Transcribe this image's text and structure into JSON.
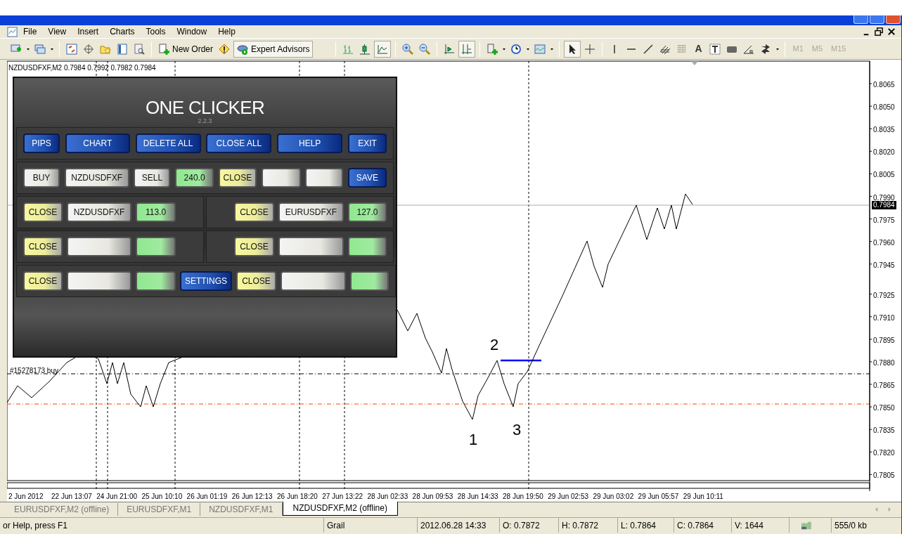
{
  "menu": [
    "File",
    "View",
    "Insert",
    "Charts",
    "Tools",
    "Window",
    "Help"
  ],
  "toolbar": {
    "new_order": "New Order",
    "expert_advisors": {
      "label": "Expert Advisors",
      "on": true
    },
    "text_tool": "A",
    "timeframes": [
      {
        "label": "M1",
        "disabled": true
      },
      {
        "label": "M5",
        "disabled": true
      },
      {
        "label": "M15",
        "disabled": true
      }
    ]
  },
  "chart": {
    "header": "NZDUSDFXF,M2  0.7984 0.7992 0.7982 0.7984",
    "order_label": "#15278173 buy",
    "current_price": "0.7984",
    "price_labels": [
      "0.8065",
      "0.8050",
      "0.8035",
      "0.8020",
      "0.8005",
      "0.7990",
      "0.7975",
      "0.7960",
      "0.7945",
      "0.7925",
      "0.7910",
      "0.7895",
      "0.7880",
      "0.7865",
      "0.7850",
      "0.7835",
      "0.7820",
      "0.7805"
    ],
    "time_labels": [
      "2 Jun 2012",
      "22 Jun 13:07",
      "24 Jun 21:00",
      "25 Jun 10:10",
      "26 Jun 01:19",
      "26 Jun 12:13",
      "26 Jun 18:20",
      "27 Jun 13:22",
      "28 Jun 02:33",
      "28 Jun 09:53",
      "28 Jun 14:33",
      "28 Jun 19:50",
      "29 Jun 02:53",
      "29 Jun 03:02",
      "29 Jun 05:57",
      "29 Jun 10:11"
    ],
    "annotations": [
      "1",
      "2",
      "3"
    ]
  },
  "panel": {
    "title": "ONE CLICKER",
    "version": "2.2.3",
    "rows": [
      [
        {
          "label": "PIPS",
          "kind": "blue"
        },
        {
          "label": "CHART",
          "kind": "blue"
        },
        {
          "label": "DELETE ALL",
          "kind": "blue"
        },
        {
          "label": "CLOSE ALL",
          "kind": "blue"
        },
        {
          "label": "HELP",
          "kind": "blue"
        },
        {
          "label": "EXIT",
          "kind": "blue"
        }
      ],
      [
        {
          "label": "BUY",
          "kind": "white"
        },
        {
          "label": "NZDUSDFXF",
          "kind": "white"
        },
        {
          "label": "SELL",
          "kind": "white"
        },
        {
          "label": "240.0",
          "kind": "green"
        },
        {
          "label": "CLOSE",
          "kind": "yellow"
        },
        {
          "kind": "white"
        },
        {
          "kind": "white"
        },
        {
          "label": "SAVE",
          "kind": "blue"
        }
      ],
      [
        {
          "label": "CLOSE",
          "kind": "yellow"
        },
        {
          "label": "NZDUSDFXF",
          "kind": "white"
        },
        {
          "label": "113.0",
          "kind": "green"
        },
        {
          "label": "CLOSE",
          "kind": "yellow"
        },
        {
          "label": "EURUSDFXF",
          "kind": "white"
        },
        {
          "label": "127.0",
          "kind": "green"
        }
      ],
      [
        {
          "label": "CLOSE",
          "kind": "yellow"
        },
        {
          "kind": "white"
        },
        {
          "kind": "green"
        },
        {
          "label": "CLOSE",
          "kind": "yellow"
        },
        {
          "kind": "white"
        },
        {
          "kind": "green"
        }
      ],
      [
        {
          "label": "CLOSE",
          "kind": "yellow"
        },
        {
          "kind": "white"
        },
        {
          "kind": "green"
        },
        {
          "label": "SETTINGS",
          "kind": "blue"
        },
        {
          "label": "CLOSE",
          "kind": "yellow"
        },
        {
          "kind": "white"
        },
        {
          "kind": "green"
        }
      ]
    ]
  },
  "tabs": [
    {
      "label": "EURUSDFXF,M2 (offline)",
      "selected": false
    },
    {
      "label": "EURUSDFXF,M1",
      "selected": false
    },
    {
      "label": "NZDUSDFXF,M1",
      "selected": false
    },
    {
      "label": "NZDUSDFXF,M2 (offline)",
      "selected": true
    }
  ],
  "status_bar": [
    "or Help, press F1",
    "Grail",
    "2012.06.28 14:33",
    "O: 0.7872",
    "H: 0.7872",
    "L: 0.7864",
    "C: 0.7864",
    "V: 1644",
    "555/0 kb"
  ]
}
